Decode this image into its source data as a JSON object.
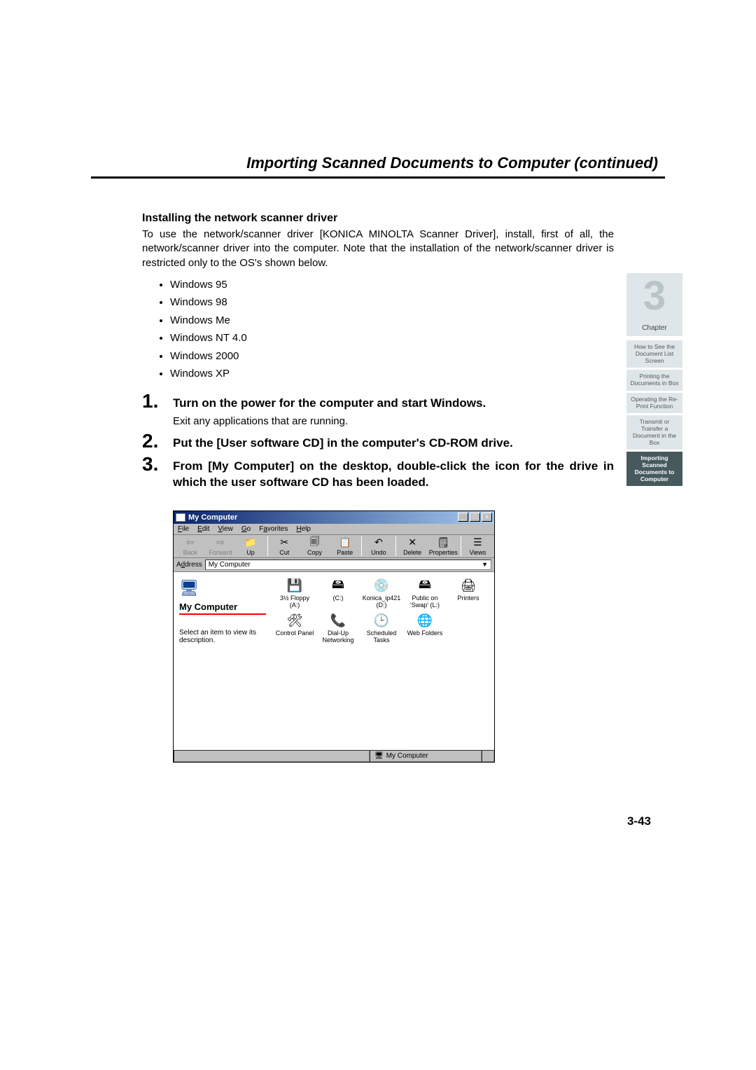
{
  "header": {
    "section_title": "Importing Scanned Documents to Computer (continued)"
  },
  "content": {
    "subheading": "Installing the network scanner driver",
    "intro": "To use the network/scanner driver [KONICA MINOLTA Scanner Driver], install, first of all, the network/scanner driver into the computer. Note that the installation of the network/scanner driver is restricted only to the OS's shown below.",
    "os_list": [
      "Windows 95",
      "Windows 98",
      "Windows Me",
      "Windows NT 4.0",
      "Windows 2000",
      "Windows XP"
    ],
    "steps": [
      {
        "title": "Turn on the power for the computer and start Windows.",
        "note": "Exit any applications that are running."
      },
      {
        "title": "Put the [User software CD] in the computer's CD-ROM drive."
      },
      {
        "title": "From [My Computer] on the desktop, double-click the icon for the drive in which the user software CD has been loaded."
      }
    ]
  },
  "win": {
    "title": "My Computer",
    "menu": {
      "file": "File",
      "edit": "Edit",
      "view": "View",
      "go": "Go",
      "favorites": "Favorites",
      "help": "Help"
    },
    "toolbar": {
      "back": "Back",
      "forward": "Forward",
      "up": "Up",
      "cut": "Cut",
      "copy": "Copy",
      "paste": "Paste",
      "undo": "Undo",
      "delete": "Delete",
      "properties": "Properties",
      "views": "Views"
    },
    "address_label": "Address",
    "address_value": "My Computer",
    "side": {
      "title": "My Computer",
      "hint": "Select an item to view its description."
    },
    "icons": {
      "floppy": "3½ Floppy (A:)",
      "c": "(C:)",
      "cd": "Konica_ip421 (D:)",
      "public": "Public on 'Swap' (L:)",
      "printers": "Printers",
      "cpanel": "Control Panel",
      "dialup": "Dial-Up Networking",
      "tasks": "Scheduled Tasks",
      "webfolders": "Web Folders"
    },
    "status": "My Computer"
  },
  "nav": {
    "chapter_label": "Chapter",
    "chapter_num": "3",
    "tabs": [
      "How to See the Document List Screen",
      "Printing the Documents in Box",
      "Operating the Re-Print Function",
      "Transmit or Transfer a Document in the Box",
      "Importing Scanned Documents to Computer"
    ],
    "active_index": 4
  },
  "page_number": "3-43"
}
